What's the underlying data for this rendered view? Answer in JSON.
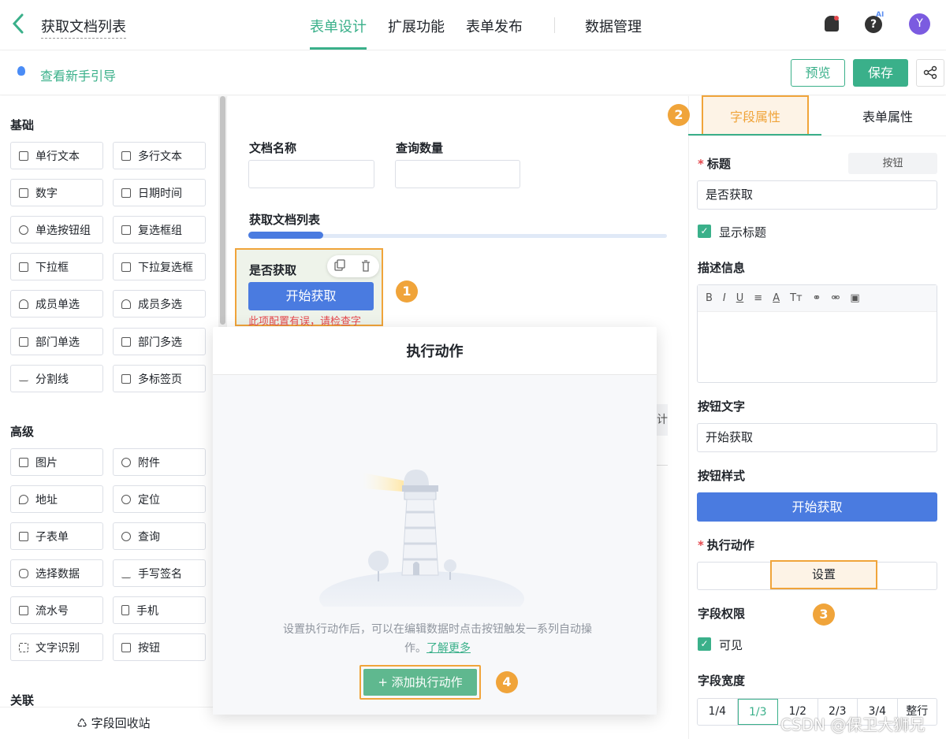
{
  "header": {
    "title": "获取文档列表",
    "tabs": [
      "表单设计",
      "扩展功能",
      "表单发布",
      "数据管理"
    ],
    "ai_label": "AI",
    "avatar_letter": "Y"
  },
  "toolbar": {
    "guide_link": "查看新手引导",
    "preview_label": "预览",
    "save_label": "保存"
  },
  "palette": {
    "sections": [
      {
        "title": "基础",
        "items": [
          "单行文本",
          "多行文本",
          "数字",
          "日期时间",
          "单选按钮组",
          "复选框组",
          "下拉框",
          "下拉复选框",
          "成员单选",
          "成员多选",
          "部门单选",
          "部门多选",
          "分割线",
          "多标签页"
        ]
      },
      {
        "title": "高级",
        "items": [
          "图片",
          "附件",
          "地址",
          "定位",
          "子表单",
          "查询",
          "选择数据",
          "手写签名",
          "流水号",
          "手机",
          "文字识别",
          "按钮"
        ]
      },
      {
        "title": "关联",
        "items": []
      }
    ],
    "recycle_label": "字段回收站"
  },
  "canvas": {
    "field1_label": "文档名称",
    "field2_label": "查询数量",
    "section_title": "获取文档列表",
    "button_field_label": "是否获取",
    "button_text": "开始获取",
    "error_text": "此项配置有误，请检查字",
    "partial_text": "计间"
  },
  "modal": {
    "title": "执行动作",
    "desc": "设置执行动作后，可以在编辑数据时点击按钮触发一系列自动操作。",
    "learn_more": "了解更多",
    "add_button": "+ 添加执行动作"
  },
  "props": {
    "tabs": [
      "字段属性",
      "表单属性"
    ],
    "title_label": "标题",
    "title_tag": "按钮",
    "title_value": "是否获取",
    "show_title": "显示标题",
    "desc_label": "描述信息",
    "editor_tools": [
      "B",
      "I",
      "U",
      "≡",
      "A",
      "Tт",
      "⚭",
      "⚮",
      "▣"
    ],
    "btn_text_label": "按钮文字",
    "btn_text_value": "开始获取",
    "btn_style_label": "按钮样式",
    "btn_style_preview": "开始获取",
    "action_label": "执行动作",
    "action_button": "设置",
    "perm_label": "字段权限",
    "visible_label": "可见",
    "width_label": "字段宽度",
    "widths": [
      "1/4",
      "1/3",
      "1/2",
      "2/3",
      "3/4",
      "整行"
    ],
    "selected_width": "1/3"
  },
  "badges": [
    "1",
    "2",
    "3",
    "4"
  ],
  "watermark": "CSDN @保卫大狮兄",
  "colors": {
    "accent": "#3ab08a",
    "primary_button": "#4a7be0",
    "highlight": "#f0a43a",
    "error": "#e5484d"
  }
}
